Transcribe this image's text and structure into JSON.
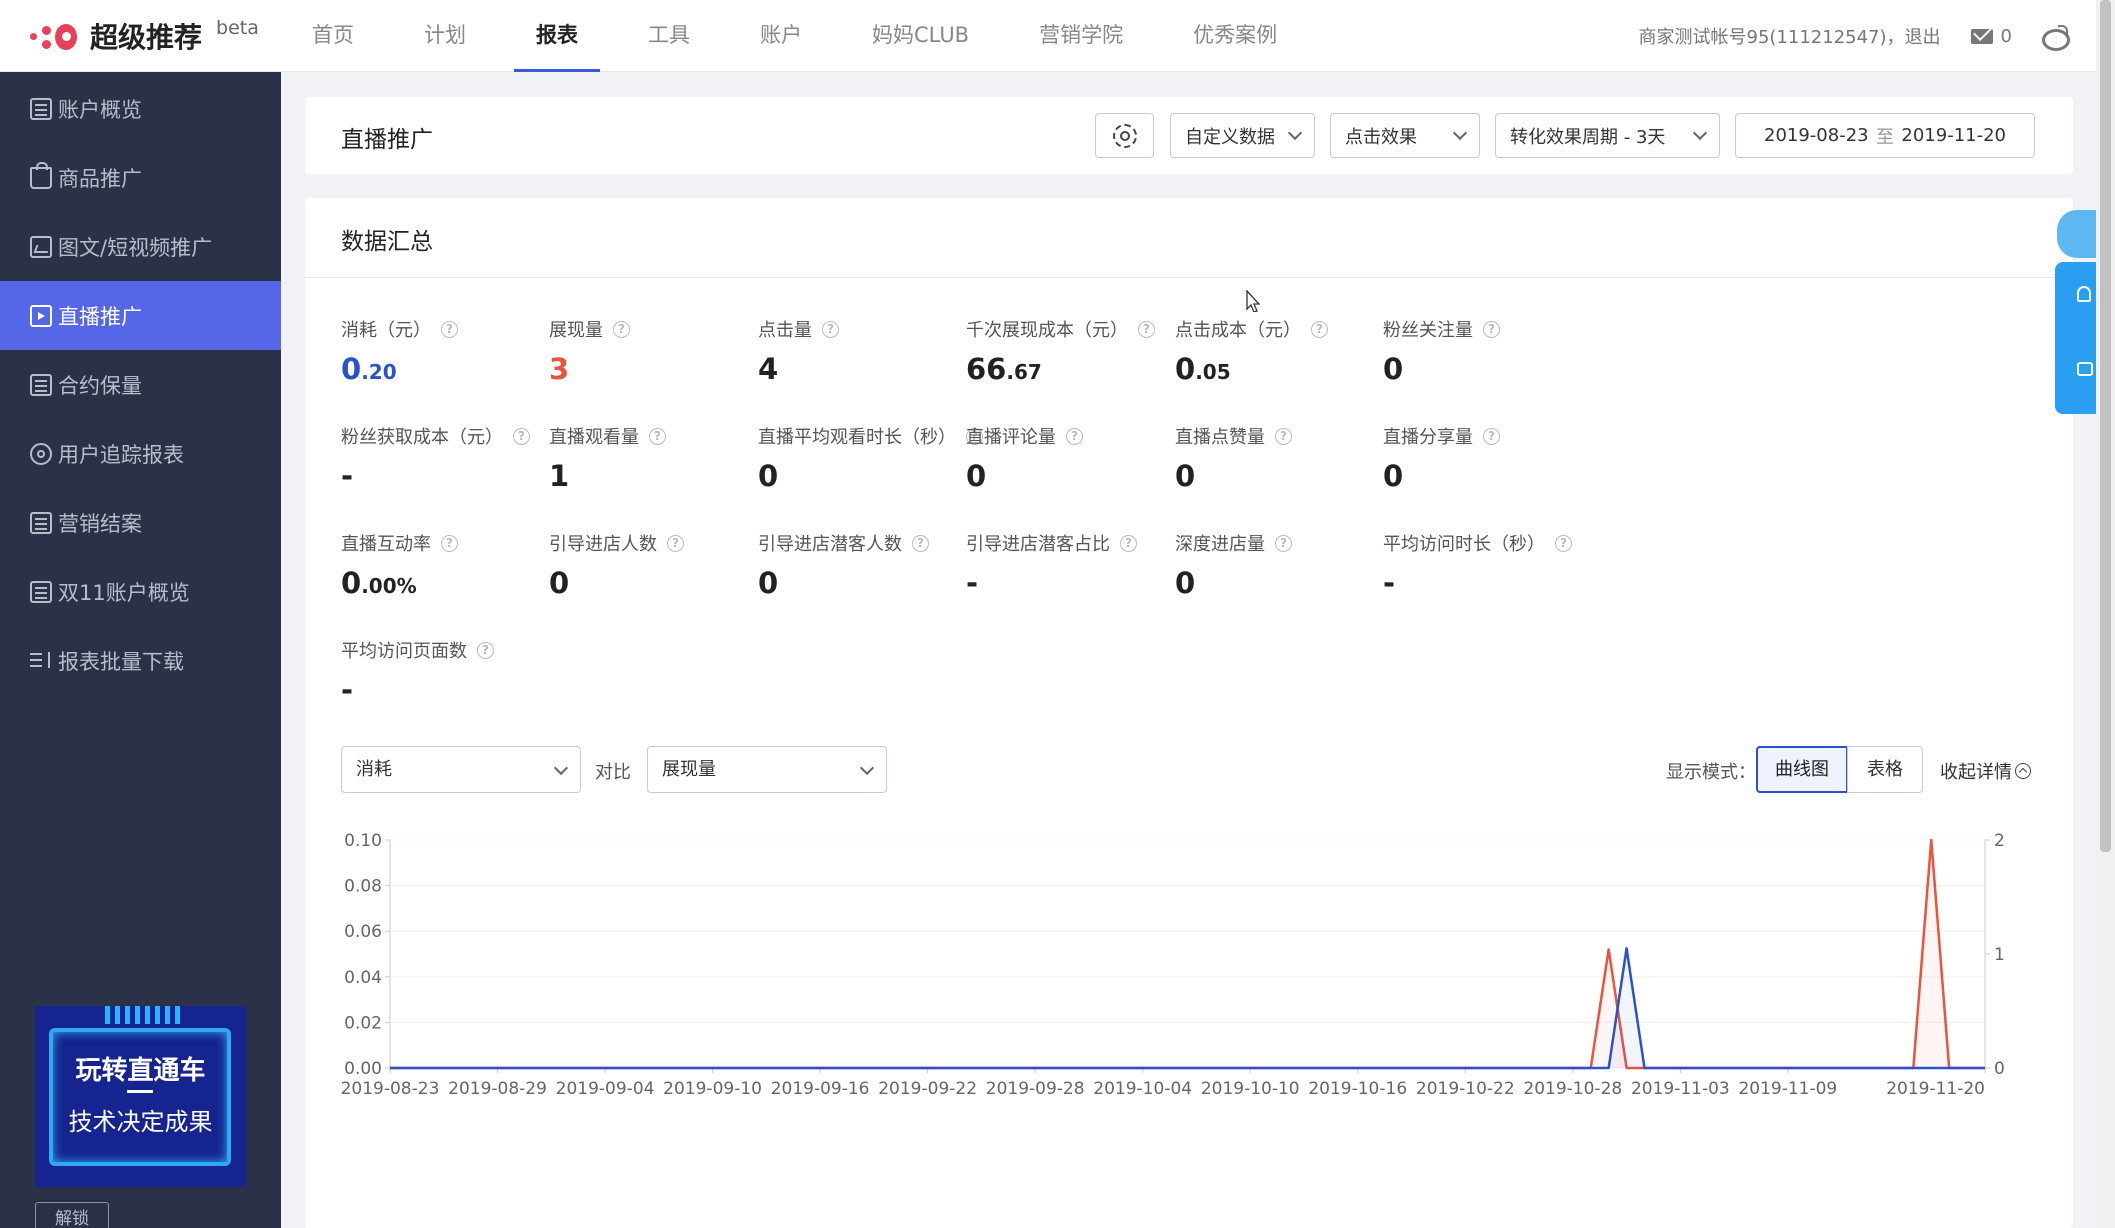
{
  "brand": {
    "title": "超级推荐",
    "tag": "beta"
  },
  "nav": [
    {
      "label": "首页",
      "active": false
    },
    {
      "label": "计划",
      "active": false
    },
    {
      "label": "报表",
      "active": true
    },
    {
      "label": "工具",
      "active": false
    },
    {
      "label": "账户",
      "active": false
    },
    {
      "label": "妈妈CLUB",
      "active": false
    },
    {
      "label": "营销学院",
      "active": false
    },
    {
      "label": "优秀案例",
      "active": false
    }
  ],
  "topbar": {
    "account": "商家测试帐号95(111212547)，退出",
    "mail_count": "0"
  },
  "sidebar": {
    "items": [
      {
        "label": "账户概览",
        "icon": "account-overview-icon"
      },
      {
        "label": "商品推广",
        "icon": "shopping-bag-icon"
      },
      {
        "label": "图文/短视频推广",
        "icon": "image-icon"
      },
      {
        "label": "直播推广",
        "icon": "live-play-icon",
        "active": true
      },
      {
        "label": "合约保量",
        "icon": "contract-icon"
      },
      {
        "label": "用户追踪报表",
        "icon": "tracking-icon"
      },
      {
        "label": "营销结案",
        "icon": "board-icon"
      },
      {
        "label": "双11账户概览",
        "icon": "double11-icon"
      },
      {
        "label": "报表批量下载",
        "icon": "batch-download-icon"
      }
    ],
    "promo": {
      "line1": "玩转直通车",
      "line2": "技术决定成果"
    },
    "unlock": "解锁"
  },
  "header": {
    "title": "直播推广",
    "custom_data": "自定义数据",
    "click_effect": "点击效果",
    "conversion_period": "转化效果周期 - 3天",
    "date_start": "2019-08-23",
    "date_sep": "至",
    "date_end": "2019-11-20"
  },
  "summary": {
    "title": "数据汇总",
    "metrics": [
      {
        "label": "消耗（元）",
        "int": "0",
        "dec": ".20",
        "color": "blue"
      },
      {
        "label": "展现量",
        "int": "3",
        "dec": "",
        "color": "red"
      },
      {
        "label": "点击量",
        "int": "4",
        "dec": ""
      },
      {
        "label": "千次展现成本（元）",
        "int": "66",
        "dec": ".67"
      },
      {
        "label": "点击成本（元）",
        "int": "0",
        "dec": ".05"
      },
      {
        "label": "粉丝关注量",
        "int": "0",
        "dec": ""
      },
      {
        "label": "粉丝获取成本（元）",
        "int": "-",
        "dec": ""
      },
      {
        "label": "直播观看量",
        "int": "1",
        "dec": ""
      },
      {
        "label": "直播平均观看时长（秒）",
        "int": "0",
        "dec": ""
      },
      {
        "label": "直播评论量",
        "int": "0",
        "dec": ""
      },
      {
        "label": "直播点赞量",
        "int": "0",
        "dec": ""
      },
      {
        "label": "直播分享量",
        "int": "0",
        "dec": ""
      },
      {
        "label": "直播互动率",
        "int": "0",
        "dec": ".00%"
      },
      {
        "label": "引导进店人数",
        "int": "0",
        "dec": ""
      },
      {
        "label": "引导进店潜客人数",
        "int": "0",
        "dec": ""
      },
      {
        "label": "引导进店潜客占比",
        "int": "-",
        "dec": ""
      },
      {
        "label": "深度进店量",
        "int": "0",
        "dec": ""
      },
      {
        "label": "平均访问时长（秒）",
        "int": "-",
        "dec": ""
      },
      {
        "label": "平均访问页面数",
        "int": "-",
        "dec": ""
      }
    ]
  },
  "chart_controls": {
    "metric_a": "消耗",
    "vs": "对比",
    "metric_b": "展现量",
    "mode_label": "显示模式：",
    "mode_curve": "曲线图",
    "mode_table": "表格",
    "collapse": "收起详情"
  },
  "colors": {
    "primary": "#5566e6",
    "series_left": "#e9543e",
    "series_right": "#2b52c9"
  },
  "chart_data": {
    "type": "line",
    "x_ticks": [
      "2019-08-23",
      "2019-08-29",
      "2019-09-04",
      "2019-09-10",
      "2019-09-16",
      "2019-09-22",
      "2019-09-28",
      "2019-10-04",
      "2019-10-10",
      "2019-10-16",
      "2019-10-22",
      "2019-10-28",
      "2019-11-03",
      "2019-11-09",
      "2019-11-20"
    ],
    "y_left_ticks": [
      "0.10",
      "0.08",
      "0.06",
      "0.04",
      "0.02",
      "0.00"
    ],
    "y_right_ticks": [
      "2",
      "1",
      "0"
    ],
    "y_left_range": [
      0,
      0.1
    ],
    "y_right_range": [
      0,
      2
    ],
    "series": [
      {
        "axis": "left",
        "color": "#e9543e",
        "points": [
          [
            "2019-08-23",
            0
          ],
          [
            "2019-10-29",
            0
          ],
          [
            "2019-10-30",
            0.052
          ],
          [
            "2019-10-31",
            0
          ],
          [
            "2019-11-16",
            0
          ],
          [
            "2019-11-17",
            0.1
          ],
          [
            "2019-11-18",
            0
          ],
          [
            "2019-11-20",
            0
          ]
        ]
      },
      {
        "axis": "right",
        "color": "#2b52c9",
        "points": [
          [
            "2019-08-23",
            0
          ],
          [
            "2019-10-30",
            0
          ],
          [
            "2019-10-31",
            1.05
          ],
          [
            "2019-11-01",
            0
          ],
          [
            "2019-11-20",
            0
          ]
        ]
      }
    ]
  }
}
